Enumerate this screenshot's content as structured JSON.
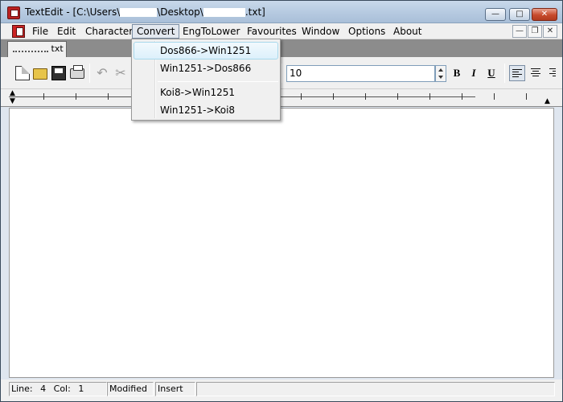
{
  "window": {
    "title_prefix": "TextEdit - [C:\\Users\\",
    "title_mid": "\\Desktop\\",
    "title_suffix": ".txt]"
  },
  "menubar": {
    "items": [
      "File",
      "Edit",
      "Character",
      "Convert",
      "EngToLower",
      "Favourites",
      "Window",
      "Options",
      "About"
    ],
    "active": "Convert"
  },
  "convert_menu": {
    "items": [
      "Dos866->Win1251",
      "Win1251->Dos866",
      "Koi8->Win1251",
      "Win1251->Koi8"
    ],
    "highlighted": "Dos866->Win1251"
  },
  "document_tab": {
    "label_suffix": "txt"
  },
  "toolbar": {
    "font_size": "10",
    "bold": "B",
    "italic": "I",
    "underline": "U"
  },
  "icons": [
    "new-file-icon",
    "open-folder-icon",
    "save-icon",
    "print-icon",
    "undo-icon",
    "cut-icon",
    "align-left-icon",
    "align-center-icon",
    "align-right-icon"
  ],
  "statusbar": {
    "line_label": "Line:",
    "line": "4",
    "col_label": "Col:",
    "col": "1",
    "modified": "Modified",
    "mode": "Insert"
  },
  "colors": {
    "close_button": "#c74a2c",
    "menu_highlight": "#dcf0fb"
  }
}
